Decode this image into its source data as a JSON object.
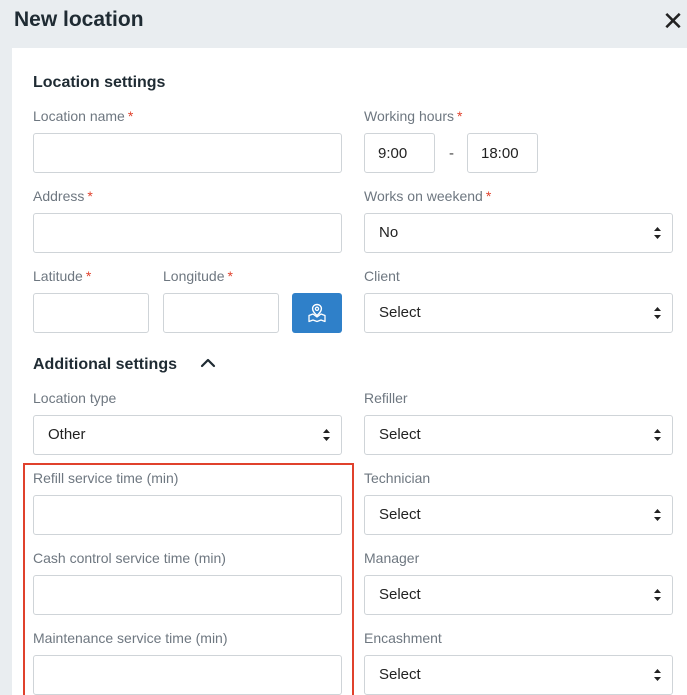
{
  "dialog": {
    "title": "New location",
    "close_glyph": "✕"
  },
  "location_settings": {
    "title": "Location settings",
    "location_name": {
      "label": "Location name",
      "required_mark": "*",
      "value": ""
    },
    "working_hours": {
      "label": "Working hours",
      "required_mark": "*",
      "from": "9:00",
      "separator": "-",
      "to": "18:00"
    },
    "address": {
      "label": "Address",
      "required_mark": "*",
      "value": ""
    },
    "works_on_weekend": {
      "label": "Works on weekend",
      "required_mark": "*",
      "value": "No"
    },
    "latitude": {
      "label": "Latitude",
      "required_mark": "*",
      "value": ""
    },
    "longitude": {
      "label": "Longitude",
      "required_mark": "*",
      "value": ""
    },
    "map_button_icon": "map-pin-icon",
    "client": {
      "label": "Client",
      "value": "Select"
    }
  },
  "additional_settings": {
    "title": "Additional settings",
    "toggle_icon": "chevron-up-icon",
    "location_type": {
      "label": "Location type",
      "value": "Other"
    },
    "refiller": {
      "label": "Refiller",
      "value": "Select"
    },
    "refill_service_time": {
      "label": "Refill service time (min)",
      "value": ""
    },
    "technician": {
      "label": "Technician",
      "value": "Select"
    },
    "cash_control_service_time": {
      "label": "Cash control service time (min)",
      "value": ""
    },
    "manager": {
      "label": "Manager",
      "value": "Select"
    },
    "maintenance_service_time": {
      "label": "Maintenance service time (min)",
      "value": ""
    },
    "encashment": {
      "label": "Encashment",
      "value": "Select"
    }
  },
  "colors": {
    "required": "#e0412c",
    "accent": "#2f80c9",
    "highlight": "#e0412c",
    "header_bg": "#e9edf0"
  }
}
